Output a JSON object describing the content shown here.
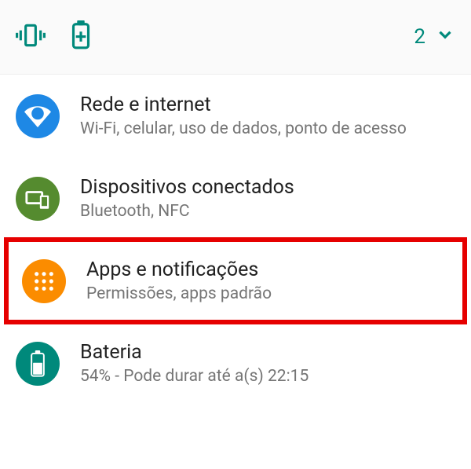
{
  "statusBar": {
    "count": "2"
  },
  "settings": [
    {
      "title": "Rede e internet",
      "subtitle": "Wi-Fi, celular, uso de dados, ponto de acesso"
    },
    {
      "title": "Dispositivos conectados",
      "subtitle": "Bluetooth, NFC"
    },
    {
      "title": "Apps e notificações",
      "subtitle": "Permissões, apps padrão"
    },
    {
      "title": "Bateria",
      "subtitle": "54% - Pode durar até a(s) 22:15"
    }
  ]
}
